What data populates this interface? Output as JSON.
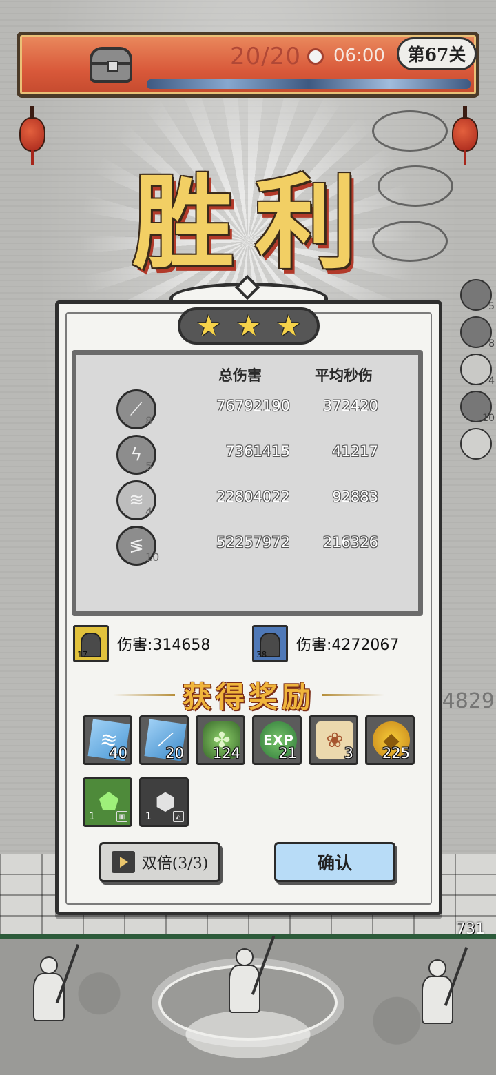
{
  "header": {
    "progress": "20/20",
    "timer": "06:00",
    "level": "第67关"
  },
  "title": "胜利",
  "stars": {
    "earned": 3,
    "total": 3
  },
  "damage_table": {
    "col_total": "总伤害",
    "col_dps": "平均秒伤",
    "rows": [
      {
        "icon": "slash-skill-icon",
        "level": "8",
        "total": "76792190",
        "dps": "372420"
      },
      {
        "icon": "lightning-skill-icon",
        "level": "5",
        "total": "7361415",
        "dps": "41217"
      },
      {
        "icon": "tornado-skill-icon",
        "level": "4",
        "total": "22804022",
        "dps": "92883"
      },
      {
        "icon": "chain-lightning-skill-icon",
        "level": "10",
        "total": "52257972",
        "dps": "216326"
      }
    ]
  },
  "heroes": [
    {
      "level": "17",
      "damage": "伤害:314658",
      "frame_color": "#e2c23c"
    },
    {
      "level": "38",
      "damage": "伤害:4272067",
      "frame_color": "#4f79b8"
    }
  ],
  "rewards": {
    "title": "获得奖励",
    "items": [
      {
        "icon": "tornado-card-icon",
        "qty": "40"
      },
      {
        "icon": "slash-card-icon",
        "qty": "20"
      },
      {
        "icon": "green-rune-icon",
        "qty": "124"
      },
      {
        "icon": "exp-icon",
        "label": "EXP",
        "qty": "21"
      },
      {
        "icon": "scroll-icon",
        "qty": "3"
      },
      {
        "icon": "gold-coin-icon",
        "qty": "225"
      },
      {
        "icon": "green-crystal-icon",
        "qty": "1"
      },
      {
        "icon": "iron-ore-icon",
        "qty": "1"
      }
    ]
  },
  "buttons": {
    "double": "双倍(3/3)",
    "confirm": "确认"
  },
  "background": {
    "side_buff_levels": [
      "5",
      "8",
      "4",
      "10"
    ],
    "ground_number": "731",
    "side_number": "4829"
  },
  "colors": {
    "star": "#f5d24a",
    "title_gold": "#f2cf64",
    "confirm_button": "#b8dcf7",
    "banner_red": "#d9593a"
  }
}
